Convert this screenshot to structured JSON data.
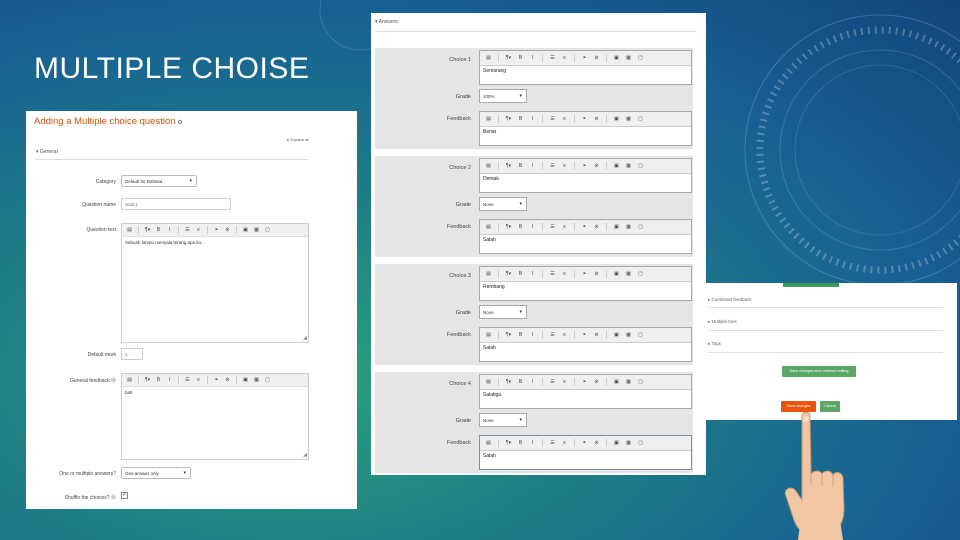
{
  "slide": {
    "title": "MULTIPLE CHOISE"
  },
  "general_panel": {
    "title": "Adding a Multiple choice question",
    "expand_all": "Expand all",
    "section": "General",
    "fields": {
      "category_label": "Category",
      "category_value": "Default for Bahasa",
      "question_name_label": "Question name",
      "question_name_value": "Soal 1",
      "question_text_label": "Question text",
      "question_text_value": "Sebuah lampu menyala terang apa itu...",
      "default_mark_label": "Default mark",
      "default_mark_value": "1",
      "general_feedback_label": "General feedback",
      "general_feedback_value": "bab",
      "one_or_multiple_label": "One or multiple answers?",
      "one_or_multiple_value": "One answer only",
      "shuffle_label": "Shuffle the choices?"
    }
  },
  "answers_panel": {
    "section": "Answers",
    "choices": [
      {
        "choice_label": "Choice 1",
        "answer": "Semarang",
        "grade_label": "Grade",
        "grade": "100%",
        "feedback_label": "Feedback",
        "feedback": "Benar"
      },
      {
        "choice_label": "Choice 2",
        "answer": "Demak",
        "grade_label": "Grade",
        "grade": "None",
        "feedback_label": "Feedback",
        "feedback": "Salah"
      },
      {
        "choice_label": "Choice 3",
        "answer": "Rembang",
        "grade_label": "Grade",
        "grade": "None",
        "feedback_label": "Feedback",
        "feedback": "Salah"
      },
      {
        "choice_label": "Choice 4",
        "answer": "Salatiga",
        "grade_label": "Grade",
        "grade": "None",
        "feedback_label": "Feedback",
        "feedback": "Salah"
      }
    ]
  },
  "save_panel": {
    "rows": [
      "Combined feedback",
      "Multiple tries",
      "Tags"
    ],
    "save_continue": "Save changes and continue editing",
    "save_changes": "Save changes",
    "cancel": "Cancel"
  },
  "colors": {
    "moodle_orange": "#e8560e",
    "moodle_green": "#5aa864",
    "title_orange": "#c8540a"
  }
}
